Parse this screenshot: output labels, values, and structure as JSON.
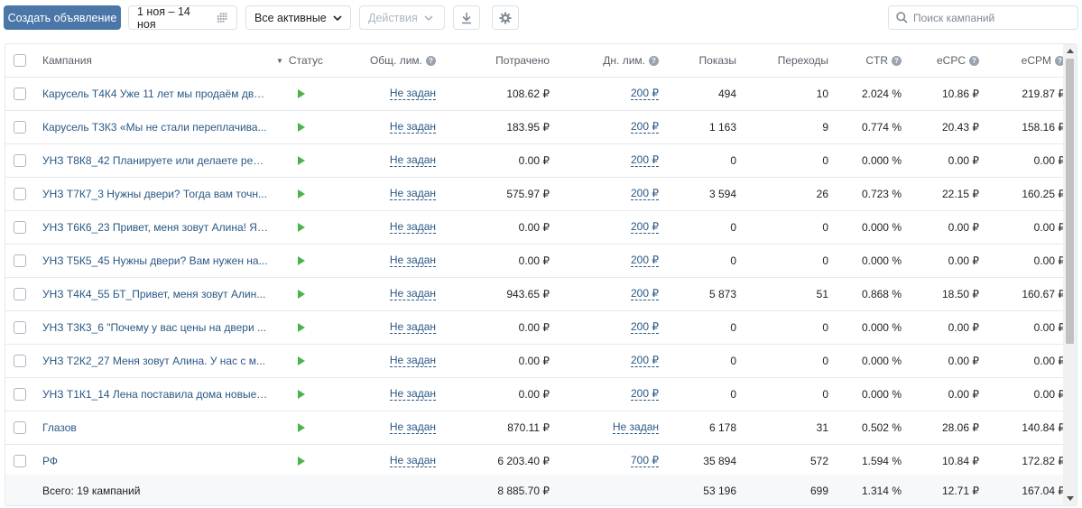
{
  "toolbar": {
    "create_label": "Создать объявление",
    "date_range": "1 ноя – 14 ноя",
    "filter_label": "Все активные",
    "actions_label": "Действия",
    "search_placeholder": "Поиск кампаний"
  },
  "columns": {
    "campaign": "Кампания",
    "status": "Статус",
    "total_limit": "Общ. лим.",
    "spent": "Потрачено",
    "daily_limit": "Дн. лим.",
    "impressions": "Показы",
    "clicks": "Переходы",
    "ctr": "CTR",
    "ecpc": "eCPC",
    "ecpm": "eCPM"
  },
  "rows": [
    {
      "name": "Карусель Т4К4 Уже 11 лет мы продаём две...",
      "total_limit": "Не задан",
      "spent": "108.62 ₽",
      "daily_limit": "200 ₽",
      "impressions": "494",
      "clicks": "10",
      "ctr": "2.024 %",
      "ecpc": "10.86 ₽",
      "ecpm": "219.87 ₽"
    },
    {
      "name": "Карусель Т3К3 «Мы не стали переплачива...",
      "total_limit": "Не задан",
      "spent": "183.95 ₽",
      "daily_limit": "200 ₽",
      "impressions": "1 163",
      "clicks": "9",
      "ctr": "0.774 %",
      "ecpc": "20.43 ₽",
      "ecpm": "158.16 ₽"
    },
    {
      "name": "УНЗ Т8К8_42 Планируете или делаете рем...",
      "total_limit": "Не задан",
      "spent": "0.00 ₽",
      "daily_limit": "200 ₽",
      "impressions": "0",
      "clicks": "0",
      "ctr": "0.000 %",
      "ecpc": "0.00 ₽",
      "ecpm": "0.00 ₽"
    },
    {
      "name": "УНЗ Т7К7_3 Нужны двери? Тогда вам точн...",
      "total_limit": "Не задан",
      "spent": "575.97 ₽",
      "daily_limit": "200 ₽",
      "impressions": "3 594",
      "clicks": "26",
      "ctr": "0.723 %",
      "ecpc": "22.15 ₽",
      "ecpm": "160.25 ₽"
    },
    {
      "name": "УНЗ Т6К6_23 Привет, меня зовут Алина! Я ...",
      "total_limit": "Не задан",
      "spent": "0.00 ₽",
      "daily_limit": "200 ₽",
      "impressions": "0",
      "clicks": "0",
      "ctr": "0.000 %",
      "ecpc": "0.00 ₽",
      "ecpm": "0.00 ₽"
    },
    {
      "name": "УНЗ Т5К5_45 Нужны двери? Вам нужен на...",
      "total_limit": "Не задан",
      "spent": "0.00 ₽",
      "daily_limit": "200 ₽",
      "impressions": "0",
      "clicks": "0",
      "ctr": "0.000 %",
      "ecpc": "0.00 ₽",
      "ecpm": "0.00 ₽"
    },
    {
      "name": "УНЗ Т4К4_55 БТ_Привет, меня зовут Алин...",
      "total_limit": "Не задан",
      "spent": "943.65 ₽",
      "daily_limit": "200 ₽",
      "impressions": "5 873",
      "clicks": "51",
      "ctr": "0.868 %",
      "ecpc": "18.50 ₽",
      "ecpm": "160.67 ₽"
    },
    {
      "name": "УНЗ Т3К3_6 \"Почему у вас цены на двери ...",
      "total_limit": "Не задан",
      "spent": "0.00 ₽",
      "daily_limit": "200 ₽",
      "impressions": "0",
      "clicks": "0",
      "ctr": "0.000 %",
      "ecpc": "0.00 ₽",
      "ecpm": "0.00 ₽"
    },
    {
      "name": "УНЗ Т2К2_27 Меня зовут Алина. У нас с м...",
      "total_limit": "Не задан",
      "spent": "0.00 ₽",
      "daily_limit": "200 ₽",
      "impressions": "0",
      "clicks": "0",
      "ctr": "0.000 %",
      "ecpc": "0.00 ₽",
      "ecpm": "0.00 ₽"
    },
    {
      "name": "УНЗ Т1К1_14 Лена поставила дома новые ...",
      "total_limit": "Не задан",
      "spent": "0.00 ₽",
      "daily_limit": "200 ₽",
      "impressions": "0",
      "clicks": "0",
      "ctr": "0.000 %",
      "ecpc": "0.00 ₽",
      "ecpm": "0.00 ₽"
    },
    {
      "name": "Глазов",
      "total_limit": "Не задан",
      "spent": "870.11 ₽",
      "daily_limit": "Не задан",
      "impressions": "6 178",
      "clicks": "31",
      "ctr": "0.502 %",
      "ecpc": "28.06 ₽",
      "ecpm": "140.84 ₽"
    },
    {
      "name": "РФ",
      "total_limit": "Не задан",
      "spent": "6 203.40 ₽",
      "daily_limit": "700 ₽",
      "impressions": "35 894",
      "clicks": "572",
      "ctr": "1.594 %",
      "ecpc": "10.84 ₽",
      "ecpm": "172.82 ₽"
    }
  ],
  "total": {
    "label": "Всего: 19 кампаний",
    "spent": "8 885.70 ₽",
    "impressions": "53 196",
    "clicks": "699",
    "ctr": "1.314 %",
    "ecpc": "12.71 ₽",
    "ecpm": "167.04 ₽"
  },
  "colors": {
    "primary": "#4a76a8",
    "link": "#2a5885",
    "active_status": "#4bb34b"
  }
}
